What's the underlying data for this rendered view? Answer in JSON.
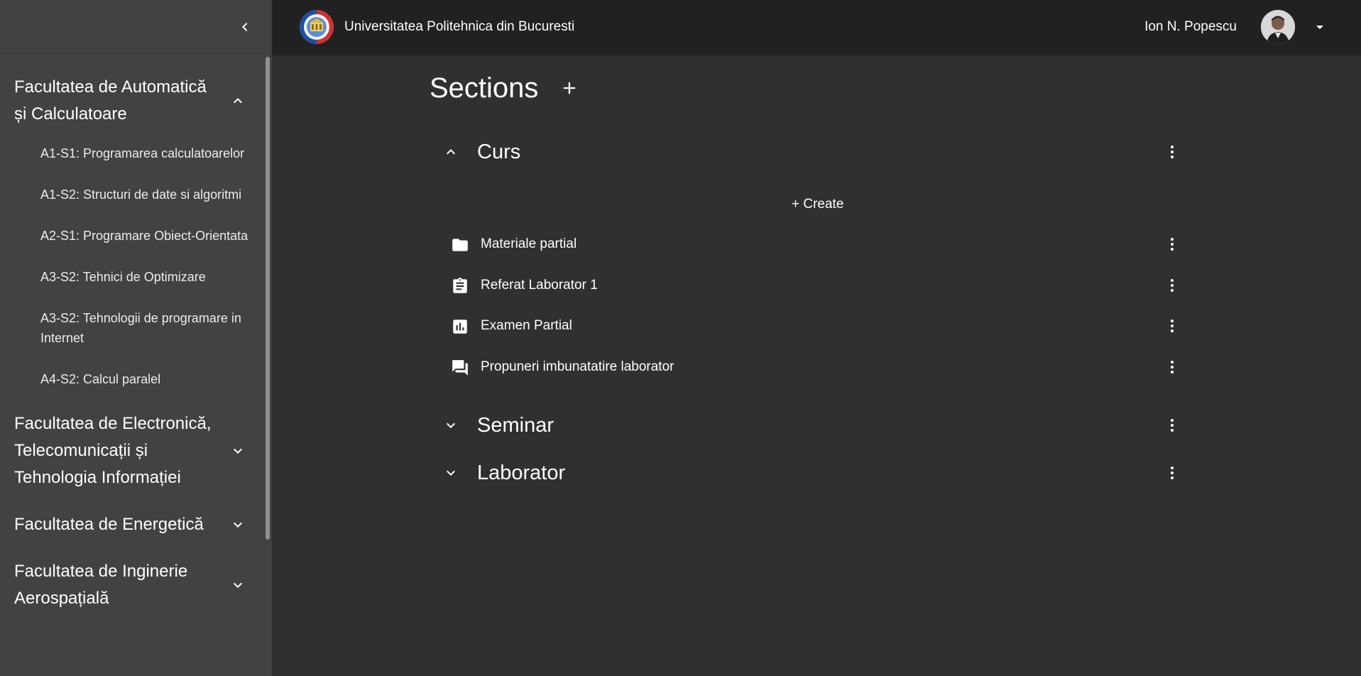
{
  "sidebar": {
    "faculties": [
      {
        "title": "Facultatea de Automatică și Calculatoare",
        "expanded": true,
        "courses": [
          "A1-S1: Programarea calculatoarelor",
          "A1-S2: Structuri de date si algoritmi",
          "A2-S1: Programare Obiect-Orientata",
          "A3-S2: Tehnici de Optimizare",
          "A3-S2: Tehnologii de programare in Internet",
          "A4-S2: Calcul paralel"
        ]
      },
      {
        "title": "Facultatea de Electronică, Telecomunicații și Tehnologia Informației",
        "expanded": false
      },
      {
        "title": "Facultatea de Energetică",
        "expanded": false
      },
      {
        "title": "Facultatea de Inginerie Aerospațială",
        "expanded": false
      }
    ]
  },
  "header": {
    "university_name": "Universitatea Politehnica din Bucuresti",
    "user_name": "Ion N. Popescu"
  },
  "main": {
    "title": "Sections",
    "create_label": "+ Create",
    "sections": [
      {
        "title": "Curs",
        "expanded": true,
        "items": [
          {
            "icon": "folder-icon",
            "label": "Materiale partial"
          },
          {
            "icon": "assignment-icon",
            "label": "Referat Laborator 1"
          },
          {
            "icon": "quiz-chart-icon",
            "label": "Examen Partial"
          },
          {
            "icon": "forum-icon",
            "label": "Propuneri imbunatatire laborator"
          }
        ]
      },
      {
        "title": "Seminar",
        "expanded": false
      },
      {
        "title": "Laborator",
        "expanded": false
      }
    ]
  },
  "colors": {
    "background": "#303030",
    "sidebar": "#424242",
    "topbar": "#212121",
    "text": "#ffffff"
  }
}
